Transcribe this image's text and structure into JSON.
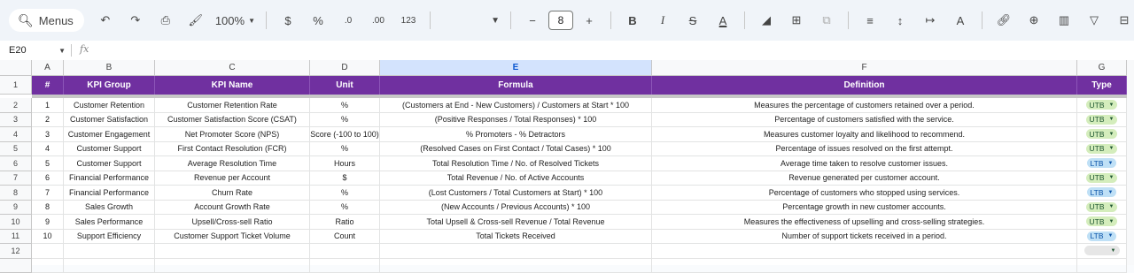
{
  "toolbar": {
    "menus_label": "Menus",
    "zoom": "100%",
    "currency": "$",
    "percent": "%",
    "dec_decrease": ".0",
    "dec_increase": ".00",
    "number_format": "123",
    "font_size": "8",
    "minus": "−",
    "plus": "+"
  },
  "formula_bar": {
    "name_box": "E20",
    "fx": "fx"
  },
  "grid": {
    "columns": [
      "A",
      "B",
      "C",
      "D",
      "E",
      "F",
      "G"
    ],
    "selected_column": "E",
    "row_numbers": [
      "1",
      "2",
      "3",
      "4",
      "5",
      "6",
      "7",
      "8",
      "9",
      "10",
      "11",
      "12"
    ],
    "header": [
      "#",
      "KPI Group",
      "KPI Name",
      "Unit",
      "Formula",
      "Definition",
      "Type"
    ],
    "rows": [
      [
        "1",
        "Customer Retention",
        "Customer Retention Rate",
        "%",
        "(Customers at End - New Customers) / Customers at Start * 100",
        "Measures the percentage of customers retained over a period.",
        "UTB"
      ],
      [
        "2",
        "Customer Satisfaction",
        "Customer Satisfaction Score (CSAT)",
        "%",
        "(Positive Responses / Total Responses) * 100",
        "Percentage of customers satisfied with the service.",
        "UTB"
      ],
      [
        "3",
        "Customer Engagement",
        "Net Promoter Score (NPS)",
        "Score (-100 to 100)",
        "% Promoters - % Detractors",
        "Measures customer loyalty and likelihood to recommend.",
        "UTB"
      ],
      [
        "4",
        "Customer Support",
        "First Contact Resolution (FCR)",
        "%",
        "(Resolved Cases on First Contact / Total Cases) * 100",
        "Percentage of issues resolved on the first attempt.",
        "UTB"
      ],
      [
        "5",
        "Customer Support",
        "Average Resolution Time",
        "Hours",
        "Total Resolution Time / No. of Resolved Tickets",
        "Average time taken to resolve customer issues.",
        "LTB"
      ],
      [
        "6",
        "Financial Performance",
        "Revenue per Account",
        "$",
        "Total Revenue / No. of Active Accounts",
        "Revenue generated per customer account.",
        "UTB"
      ],
      [
        "7",
        "Financial Performance",
        "Churn Rate",
        "%",
        "(Lost Customers / Total Customers at Start) * 100",
        "Percentage of customers who stopped using services.",
        "LTB"
      ],
      [
        "8",
        "Sales Growth",
        "Account Growth Rate",
        "%",
        "(New Accounts / Previous Accounts) * 100",
        "Percentage growth in new customer accounts.",
        "UTB"
      ],
      [
        "9",
        "Sales Performance",
        "Upsell/Cross-sell Ratio",
        "Ratio",
        "Total Upsell & Cross-sell Revenue / Total Revenue",
        "Measures the effectiveness of upselling and cross-selling strategies.",
        "UTB"
      ],
      [
        "10",
        "Support Efficiency",
        "Customer Support Ticket Volume",
        "Count",
        "Total Tickets Received",
        "Number of support tickets received in a period.",
        "LTB"
      ],
      [
        "",
        "",
        "",
        "",
        "",
        "",
        ""
      ]
    ]
  },
  "colors": {
    "header_bg": "#7030a0",
    "utb_chip": "#d4edbc",
    "ltb_chip": "#bfe0f6",
    "selected_col": "#d3e3fd"
  }
}
